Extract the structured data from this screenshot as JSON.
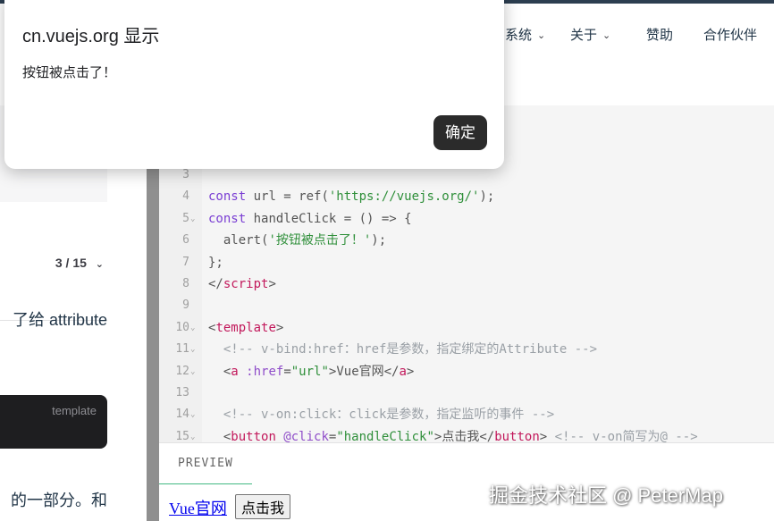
{
  "top_nav": {
    "items": [
      {
        "label": "系统",
        "has_dropdown": true
      },
      {
        "label": "关于",
        "has_dropdown": true
      },
      {
        "label": "赞助",
        "has_dropdown": false
      },
      {
        "label": "合作伙伴",
        "has_dropdown": false
      }
    ]
  },
  "left_panel": {
    "page_indicator": "3 / 15",
    "text_fragment_1": "了给 attribute",
    "code_block_label": "template",
    "text_fragment_2": "的一部分。和"
  },
  "editor": {
    "lines": [
      {
        "num": "3",
        "fold": false
      },
      {
        "num": "4",
        "fold": false,
        "tokens": [
          {
            "t": "const",
            "c": "kw"
          },
          {
            "t": " url = ref(",
            "c": "pn"
          },
          {
            "t": "'https://vuejs.org/'",
            "c": "st"
          },
          {
            "t": ");",
            "c": "pn"
          }
        ]
      },
      {
        "num": "5",
        "fold": true,
        "tokens": [
          {
            "t": "const",
            "c": "kw"
          },
          {
            "t": " handleClick = () => {",
            "c": "pn"
          }
        ]
      },
      {
        "num": "6",
        "fold": false,
        "tokens": [
          {
            "t": "  alert(",
            "c": "pn"
          },
          {
            "t": "'按钮被点击了！'",
            "c": "st"
          },
          {
            "t": ");",
            "c": "pn"
          }
        ]
      },
      {
        "num": "7",
        "fold": false,
        "tokens": [
          {
            "t": "};",
            "c": "pn"
          }
        ]
      },
      {
        "num": "8",
        "fold": false,
        "tokens": [
          {
            "t": "</",
            "c": "pn"
          },
          {
            "t": "script",
            "c": "tg"
          },
          {
            "t": ">",
            "c": "pn"
          }
        ]
      },
      {
        "num": "9",
        "fold": false,
        "tokens": []
      },
      {
        "num": "10",
        "fold": true,
        "tokens": [
          {
            "t": "<",
            "c": "pn"
          },
          {
            "t": "template",
            "c": "tg"
          },
          {
            "t": ">",
            "c": "pn"
          }
        ]
      },
      {
        "num": "11",
        "fold": true,
        "tokens": [
          {
            "t": "  <!-- v-bind:href：href是参数，指定绑定的Attribute -->",
            "c": "cm"
          }
        ]
      },
      {
        "num": "12",
        "fold": true,
        "tokens": [
          {
            "t": "  <",
            "c": "pn"
          },
          {
            "t": "a",
            "c": "tg"
          },
          {
            "t": " :href",
            "c": "at"
          },
          {
            "t": "=",
            "c": "pn"
          },
          {
            "t": "\"url\"",
            "c": "st"
          },
          {
            "t": ">Vue官网</",
            "c": "pn"
          },
          {
            "t": "a",
            "c": "tg"
          },
          {
            "t": ">",
            "c": "pn"
          }
        ]
      },
      {
        "num": "13",
        "fold": false,
        "tokens": []
      },
      {
        "num": "14",
        "fold": true,
        "tokens": [
          {
            "t": "  <!-- v-on:click：click是参数，指定监听的事件 -->",
            "c": "cm"
          }
        ]
      },
      {
        "num": "15",
        "fold": true,
        "tokens": [
          {
            "t": "  <",
            "c": "pn"
          },
          {
            "t": "button",
            "c": "tg"
          },
          {
            "t": " @click",
            "c": "at"
          },
          {
            "t": "=",
            "c": "pn"
          },
          {
            "t": "\"handleClick\"",
            "c": "st"
          },
          {
            "t": ">点击我</",
            "c": "pn"
          },
          {
            "t": "button",
            "c": "tg"
          },
          {
            "t": ">",
            "c": "pn"
          },
          {
            "t": " <!-- v-on简写为@ -->",
            "c": "cm"
          }
        ]
      }
    ]
  },
  "preview": {
    "tab_label": "PREVIEW",
    "link_text": "Vue官网",
    "button_text": "点击我"
  },
  "dialog": {
    "title": "cn.vuejs.org 显示",
    "message": "按钮被点击了！",
    "ok_label": "确定"
  },
  "watermark": "掘金技术社区 @ PeterMap",
  "colors": {
    "vue_green": "#42b883",
    "dialog_button": "#2b2b2b",
    "code_keyword": "#7a3ed3",
    "code_string": "#2f8f3a",
    "code_tag": "#c2185b"
  }
}
